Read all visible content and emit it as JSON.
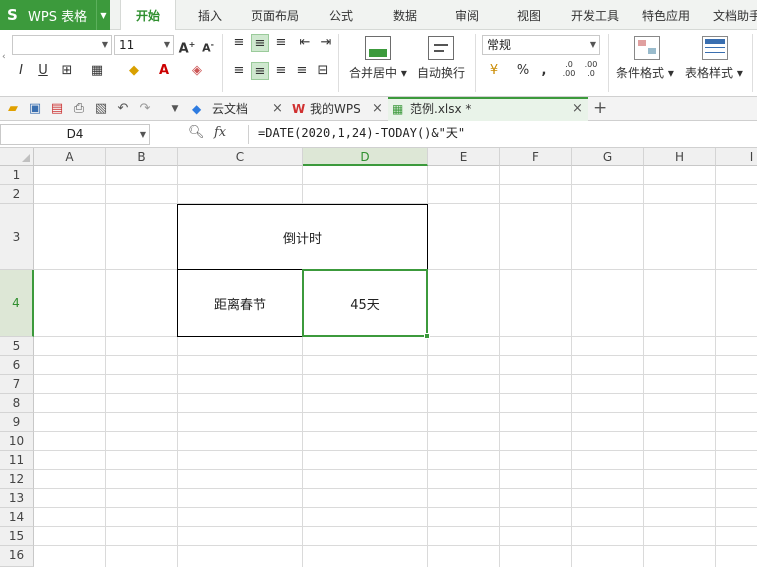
{
  "app": {
    "name": "WPS 表格",
    "logo_glyph": "S"
  },
  "menu_tabs": [
    "开始",
    "插入",
    "页面布局",
    "公式",
    "数据",
    "审阅",
    "视图",
    "开发工具",
    "特色应用",
    "文档助手"
  ],
  "ribbon": {
    "font_name": "",
    "font_size": "11",
    "merge_label": "合并居中",
    "wrap_label": "自动换行",
    "number_format": "常规",
    "conditional_format_label": "条件格式",
    "table_style_label": "表格样式",
    "percent": "%",
    "comma": ",",
    "inc_decimal": ".0 .00",
    "dec_decimal": ".00 .0"
  },
  "doc_tabs": [
    {
      "label": "云文档",
      "icon": "cloud-icon"
    },
    {
      "label": "我的WPS",
      "icon": "wps-logo-icon"
    },
    {
      "label": "范例.xlsx *",
      "icon": "spreadsheet-icon"
    }
  ],
  "formula_bar": {
    "name_box": "D4",
    "fx_label": "fx",
    "formula": "=DATE(2020,1,24)-TODAY()&\"天\""
  },
  "sheet": {
    "columns": [
      "A",
      "B",
      "C",
      "D",
      "E",
      "F",
      "G",
      "H",
      "I"
    ],
    "rows": [
      "1",
      "2",
      "3",
      "4",
      "5",
      "6",
      "7",
      "8",
      "9",
      "10",
      "11",
      "12",
      "13",
      "14",
      "15",
      "16"
    ],
    "selected_cell": "D4",
    "cells": {
      "C3": "倒计时",
      "C4": "距离春节",
      "D4": "45天"
    }
  },
  "colors": {
    "accent": "#3c9a3c",
    "menu_bg": "#f1f3f1"
  }
}
